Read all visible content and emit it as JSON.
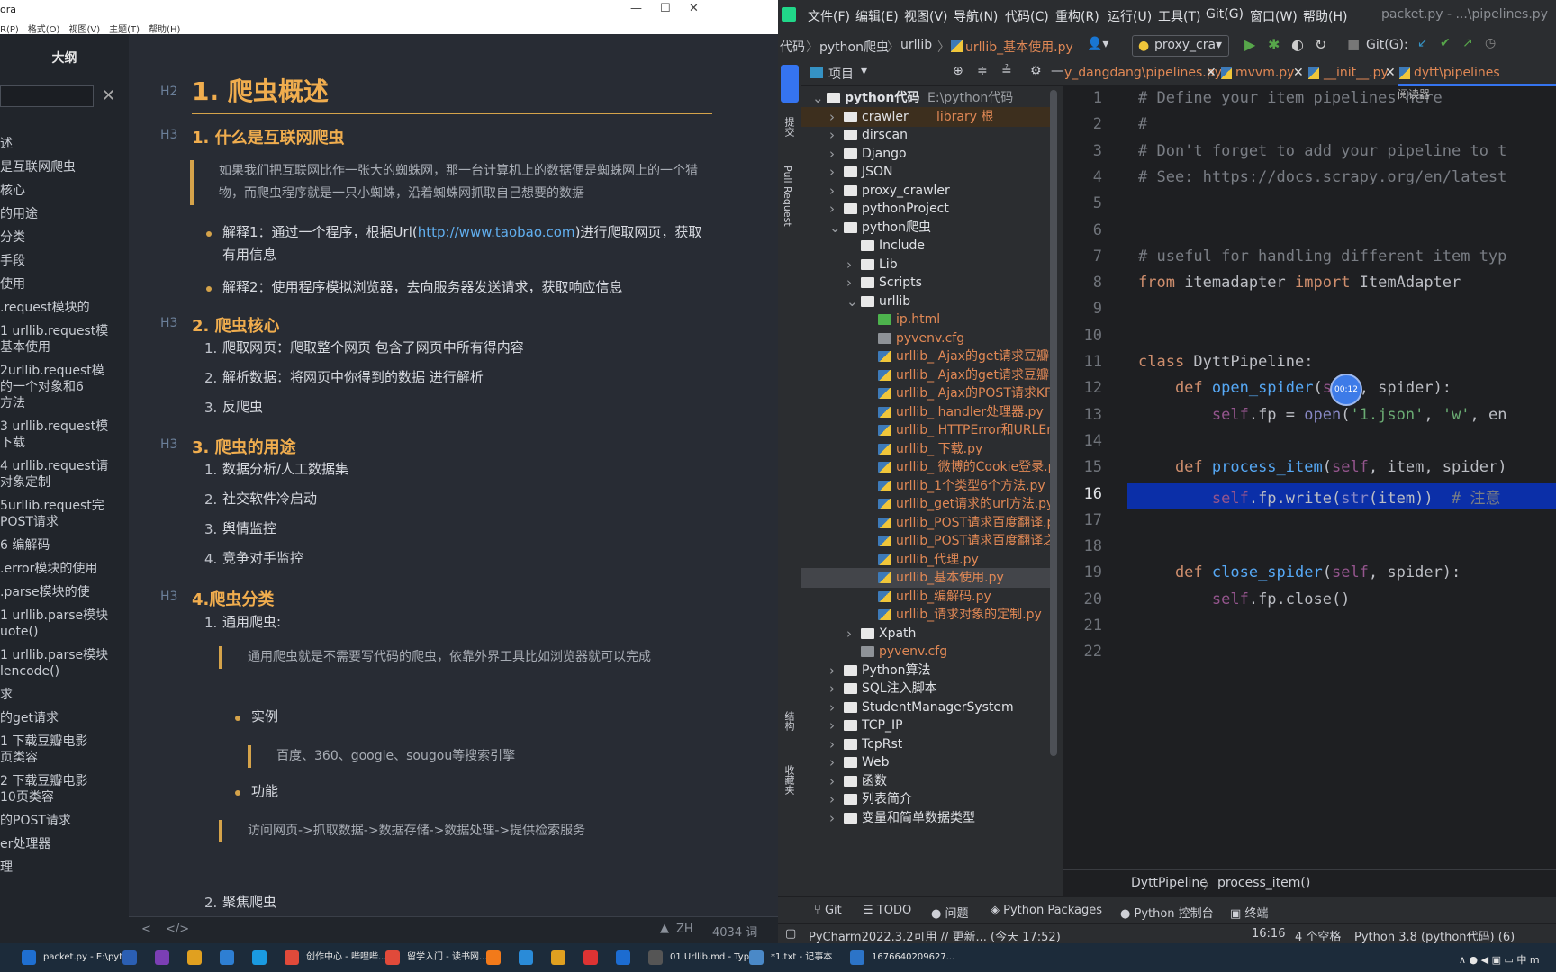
{
  "typora": {
    "title": "ora",
    "menu": [
      "R(P)",
      "格式(O)",
      "视图(V)",
      "主题(T)",
      "帮助(H)"
    ],
    "window_controls": [
      "—",
      "☐",
      "✕"
    ],
    "outline": {
      "header": "大纲",
      "items": [
        "述",
        "是互联网爬虫",
        "核心",
        "的用途",
        "分类",
        "手段",
        "使用",
        ".request模块的",
        "1 urllib.request模\n基本使用",
        "2urllib.request模\n的一个对象和6\n方法",
        "3 urllib.request模\n下载",
        "4 urllib.request请\n对象定制",
        "5urllib.request完\nPOST请求",
        "6 编解码",
        ".error模块的使用",
        ".parse模块的使",
        "1 urllib.parse模块\nuote()",
        "1 urllib.parse模块\nlencode()",
        "求",
        "的get请求",
        "1 下载豆瓣电影\n页类容",
        "2 下载豆瓣电影\n10页类容",
        "的POST请求",
        "er处理器",
        "理"
      ]
    },
    "doc": {
      "h2": "1. 爬虫概述",
      "h3_1": "1. 什么是互联网爬虫",
      "quote1": "如果我们把互联网比作一张大的蜘蛛网，那一台计算机上的数据便是蜘蛛网上的一个猎物，而爬虫程序就是一只小蜘蛛，沿着蜘蛛网抓取自己想要的数据",
      "b1_pre": "解释1：通过一个程序，根据Url(",
      "b1_link": "http://www.taobao.com",
      "b1_post": ")进行爬取网页，获取有用信息",
      "b2": "解释2：使用程序模拟浏览器，去向服务器发送请求，获取响应信息",
      "h3_2": "2. 爬虫核心",
      "core": [
        "爬取网页：爬取整个网页 包含了网页中所有得内容",
        "解析数据：将网页中你得到的数据 进行解析",
        "反爬虫"
      ],
      "h3_3": "3. 爬虫的用途",
      "uses": [
        "数据分析/人工数据集",
        "社交软件冷启动",
        "舆情监控",
        "竞争对手监控"
      ],
      "h3_4": "4.爬虫分类",
      "cat1": "通用爬虫:",
      "quote2": "通用爬虫就是不需要写代码的爬虫，依靠外界工具比如浏览器就可以完成",
      "example": "实例",
      "quote3": "百度、360、google、sougou等搜索引擎",
      "func": "功能",
      "quote4": "访问网页->抓取数据->数据存储->数据处理->提供检索服务",
      "cat2": "聚焦爬虫",
      "hlabel_h2": "H2",
      "hlabel_h3": "H3"
    },
    "footer": {
      "lang": "ZH",
      "words": "4034 词",
      "back": "<",
      "source": "</>"
    }
  },
  "pycharm": {
    "menu": [
      "文件(F)",
      "编辑(E)",
      "视图(V)",
      "导航(N)",
      "代码(C)",
      "重构(R)",
      "运行(U)",
      "工具(T)",
      "Git(G)",
      "窗口(W)",
      "帮助(H)"
    ],
    "window_title": "packet.py - ...\\pipelines.py",
    "breadcrumb": [
      "代码",
      "python爬虫",
      "urllib",
      "urllib_基本使用.py"
    ],
    "run_config": "proxy_cra",
    "git_label": "Git(G):",
    "project_label": "项目",
    "side_labels": [
      "项目",
      "提交",
      "Pull Request",
      "结构",
      "收藏夹"
    ],
    "tree": [
      {
        "d": 0,
        "exp": "v",
        "type": "folder",
        "name": "python代码",
        "extra": "E:\\python代码"
      },
      {
        "d": 1,
        "exp": ">",
        "type": "folder",
        "name": "crawler",
        "extra": "library 根"
      },
      {
        "d": 1,
        "exp": ">",
        "type": "folder",
        "name": "dirscan"
      },
      {
        "d": 1,
        "exp": ">",
        "type": "folder",
        "name": "Django"
      },
      {
        "d": 1,
        "exp": ">",
        "type": "folder",
        "name": "JSON"
      },
      {
        "d": 1,
        "exp": ">",
        "type": "folder",
        "name": "proxy_crawler"
      },
      {
        "d": 1,
        "exp": ">",
        "type": "folder",
        "name": "pythonProject"
      },
      {
        "d": 1,
        "exp": "v",
        "type": "folder",
        "name": "python爬虫"
      },
      {
        "d": 2,
        "exp": "",
        "type": "folder",
        "name": "Include"
      },
      {
        "d": 2,
        "exp": ">",
        "type": "folder",
        "name": "Lib"
      },
      {
        "d": 2,
        "exp": ">",
        "type": "folder",
        "name": "Scripts"
      },
      {
        "d": 2,
        "exp": "v",
        "type": "folder",
        "name": "urllib"
      },
      {
        "d": 3,
        "exp": "",
        "type": "html",
        "name": "ip.html"
      },
      {
        "d": 3,
        "exp": "",
        "type": "cfg",
        "name": "pyvenv.cfg"
      },
      {
        "d": 3,
        "exp": "",
        "type": "py",
        "name": "urllib_ Ajax的get请求豆瓣电影首"
      },
      {
        "d": 3,
        "exp": "",
        "type": "py",
        "name": "urllib_ Ajax的get请求豆瓣电影首"
      },
      {
        "d": 3,
        "exp": "",
        "type": "py",
        "name": "urllib_ Ajax的POST请求KFC.py"
      },
      {
        "d": 3,
        "exp": "",
        "type": "py",
        "name": "urllib_ handler处理器.py"
      },
      {
        "d": 3,
        "exp": "",
        "type": "py",
        "name": "urllib_ HTTPError和URLError.py"
      },
      {
        "d": 3,
        "exp": "",
        "type": "py",
        "name": "urllib_ 下载.py"
      },
      {
        "d": 3,
        "exp": "",
        "type": "py",
        "name": "urllib_ 微博的Cookie登录.py"
      },
      {
        "d": 3,
        "exp": "",
        "type": "py",
        "name": "urllib_1个类型6个方法.py"
      },
      {
        "d": 3,
        "exp": "",
        "type": "py",
        "name": "urllib_get请求的url方法.py"
      },
      {
        "d": 3,
        "exp": "",
        "type": "py",
        "name": "urllib_POST请求百度翻译.py"
      },
      {
        "d": 3,
        "exp": "",
        "type": "py",
        "name": "urllib_POST请求百度翻译之详细"
      },
      {
        "d": 3,
        "exp": "",
        "type": "py",
        "name": "urllib_代理.py"
      },
      {
        "d": 3,
        "exp": "",
        "type": "py",
        "name": "urllib_基本使用.py",
        "selected": true
      },
      {
        "d": 3,
        "exp": "",
        "type": "py",
        "name": "urllib_编解码.py"
      },
      {
        "d": 3,
        "exp": "",
        "type": "py",
        "name": "urllib_请求对象的定制.py"
      },
      {
        "d": 2,
        "exp": ">",
        "type": "folder",
        "name": "Xpath"
      },
      {
        "d": 2,
        "exp": "",
        "type": "cfg",
        "name": "pyvenv.cfg"
      },
      {
        "d": 1,
        "exp": ">",
        "type": "folder",
        "name": "Python算法"
      },
      {
        "d": 1,
        "exp": ">",
        "type": "folder",
        "name": "SQL注入脚本"
      },
      {
        "d": 1,
        "exp": ">",
        "type": "folder",
        "name": "StudentManagerSystem"
      },
      {
        "d": 1,
        "exp": ">",
        "type": "folder",
        "name": "TCP_IP"
      },
      {
        "d": 1,
        "exp": ">",
        "type": "folder",
        "name": "TcpRst"
      },
      {
        "d": 1,
        "exp": ">",
        "type": "folder",
        "name": "Web"
      },
      {
        "d": 1,
        "exp": ">",
        "type": "folder",
        "name": "函数"
      },
      {
        "d": 1,
        "exp": ">",
        "type": "folder",
        "name": "列表简介"
      },
      {
        "d": 1,
        "exp": ">",
        "type": "folder",
        "name": "变量和简单数据类型"
      }
    ],
    "tabs": [
      "y_dangdang\\pipelines.py",
      "mvvm.py",
      "__init__.py",
      "dytt\\pipelines"
    ],
    "reader_mode": "阅读器",
    "timer": "00:12",
    "line_numbers": [
      "1",
      "2",
      "3",
      "4",
      "5",
      "6",
      "7",
      "8",
      "9",
      "10",
      "11",
      "12",
      "13",
      "14",
      "15",
      "16",
      "17",
      "18",
      "19",
      "20",
      "21",
      "22"
    ],
    "current_line": 16,
    "code_lines": [
      [
        [
          "cm",
          "# Define your item pipelines here"
        ]
      ],
      [
        [
          "cm",
          "#"
        ]
      ],
      [
        [
          "cm",
          "# Don't forget to add your pipeline to t"
        ]
      ],
      [
        [
          "cm",
          "# See: https://docs.scrapy.org/en/latest"
        ]
      ],
      [],
      [],
      [
        [
          "cm",
          "# useful for handling different item typ"
        ]
      ],
      [
        [
          "kw",
          "from "
        ],
        [
          "id",
          "itemadapter "
        ],
        [
          "kw",
          "import "
        ],
        [
          "id",
          "ItemAdapter"
        ]
      ],
      [],
      [],
      [
        [
          "kw",
          "class "
        ],
        [
          "id",
          "DyttPipeline:"
        ]
      ],
      [
        [
          "kw",
          "    def "
        ],
        [
          "fn",
          "open_spider"
        ],
        [
          "id",
          "("
        ],
        [
          "sf",
          "self"
        ],
        [
          "id",
          ", spider):"
        ]
      ],
      [
        [
          "sf",
          "        self"
        ],
        [
          "id",
          ".fp = "
        ],
        [
          "bi",
          "open"
        ],
        [
          "id",
          "("
        ],
        [
          "st",
          "'1.json'"
        ],
        [
          "id",
          ", "
        ],
        [
          "st",
          "'w'"
        ],
        [
          "id",
          ", en"
        ]
      ],
      [],
      [
        [
          "kw",
          "    def "
        ],
        [
          "fn",
          "process_item"
        ],
        [
          "id",
          "("
        ],
        [
          "sf",
          "self"
        ],
        [
          "id",
          ", item, spider)"
        ]
      ],
      [
        [
          "sf",
          "        self"
        ],
        [
          "id",
          ".fp.write("
        ],
        [
          "bi",
          "str"
        ],
        [
          "id",
          "(item))  "
        ],
        [
          "cm",
          "# 注意"
        ]
      ],
      [],
      [],
      [
        [
          "kw",
          "    def "
        ],
        [
          "fn",
          "close_spider"
        ],
        [
          "id",
          "("
        ],
        [
          "sf",
          "self"
        ],
        [
          "id",
          ", spider):"
        ]
      ],
      [
        [
          "sf",
          "        self"
        ],
        [
          "id",
          ".fp.close()"
        ]
      ],
      [],
      []
    ],
    "editor_breadcrumb": [
      "DyttPipeline",
      "process_item()"
    ],
    "bottom_tools": [
      "Git",
      "TODO",
      "问题",
      "Python Packages",
      "Python 控制台",
      "终端"
    ],
    "status": {
      "msg": "PyCharm2022.3.2可用 // 更新... (今天 17:52)",
      "pos": "16:16",
      "indent": "4 个空格",
      "interp": "Python 3.8 (python代码) (6)"
    }
  },
  "taskbar": {
    "items": [
      {
        "label": "packet.py - E:\\pyt...",
        "color": "#1f6fd1"
      },
      {
        "label": "",
        "color": "#2b5fb3"
      },
      {
        "label": "",
        "color": "#7b3fb5"
      },
      {
        "label": "",
        "color": "#e0a020"
      },
      {
        "label": "",
        "color": "#2e7fd3"
      },
      {
        "label": "",
        "color": "#1a9ae0"
      },
      {
        "label": "创作中心 - 哔哩哔...",
        "color": "#e04a3a"
      },
      {
        "label": "留学入门 - 读书网...",
        "color": "#e04a3a"
      },
      {
        "label": "",
        "color": "#f27a1a"
      },
      {
        "label": "",
        "color": "#2a8bd8"
      },
      {
        "label": "",
        "color": "#e0a020"
      },
      {
        "label": "",
        "color": "#d33"
      },
      {
        "label": "",
        "color": "#1c6cd1"
      },
      {
        "label": "01.Urllib.md - Typ...",
        "color": "#555"
      },
      {
        "label": "*1.txt - 记事本",
        "color": "#4a89c8"
      },
      {
        "label": "1676640209627...",
        "color": "#2c74c8"
      }
    ],
    "tray": "∧ ● ◀ ▣ ▭ 中 m"
  }
}
